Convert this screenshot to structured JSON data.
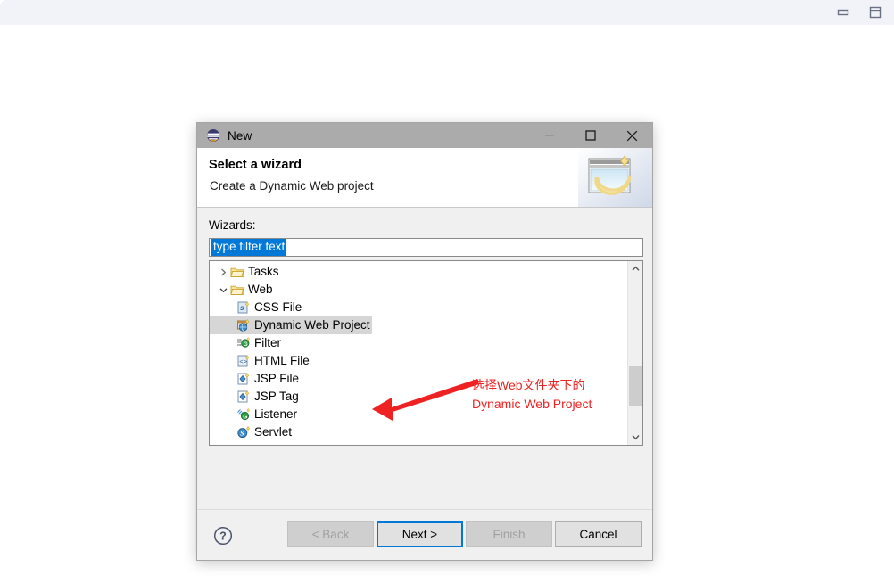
{
  "background_window": {
    "minimize_icon": "minimize-icon",
    "restore_icon": "restore-icon"
  },
  "dialog": {
    "titlebar": {
      "app_icon": "eclipse-icon",
      "title": "New",
      "minimize_label": "minimize-icon",
      "maximize_label": "maximize-icon",
      "close_label": "close-icon"
    },
    "header": {
      "title": "Select a wizard",
      "subtitle": "Create a Dynamic Web project",
      "banner_icon": "wizard-banner-icon"
    },
    "wizards_label": "Wizards:",
    "filter": {
      "value": "type filter text",
      "placeholder": "type filter text"
    },
    "tree": {
      "items": [
        {
          "label": "Tasks",
          "icon": "folder-icon",
          "indent": 1,
          "twisty": "collapsed",
          "selected": false
        },
        {
          "label": "Web",
          "icon": "folder-icon",
          "indent": 1,
          "twisty": "expanded",
          "selected": false
        },
        {
          "label": "CSS File",
          "icon": "css-file-icon",
          "indent": 2,
          "twisty": "none",
          "selected": false
        },
        {
          "label": "Dynamic Web Project",
          "icon": "web-project-icon",
          "indent": 2,
          "twisty": "none",
          "selected": true
        },
        {
          "label": "Filter",
          "icon": "filter-icon",
          "indent": 2,
          "twisty": "none",
          "selected": false
        },
        {
          "label": "HTML File",
          "icon": "html-file-icon",
          "indent": 2,
          "twisty": "none",
          "selected": false
        },
        {
          "label": "JSP File",
          "icon": "jsp-file-icon",
          "indent": 2,
          "twisty": "none",
          "selected": false
        },
        {
          "label": "JSP Tag",
          "icon": "jsp-tag-icon",
          "indent": 2,
          "twisty": "none",
          "selected": false
        },
        {
          "label": "Listener",
          "icon": "listener-icon",
          "indent": 2,
          "twisty": "none",
          "selected": false
        },
        {
          "label": "Servlet",
          "icon": "servlet-icon",
          "indent": 2,
          "twisty": "none",
          "selected": false
        }
      ],
      "scrollbar": {
        "up_icon": "chevron-up-icon",
        "down_icon": "chevron-down-icon"
      }
    },
    "annotation": {
      "line1": "选择Web文件夹下的",
      "line2": "Dynamic Web Project",
      "color": "#ee2222",
      "arrow_icon": "red-arrow-icon"
    },
    "footer": {
      "help_icon": "help-icon",
      "buttons": [
        {
          "label": "< Back",
          "state": "disabled"
        },
        {
          "label": "Next >",
          "state": "focused"
        },
        {
          "label": "Finish",
          "state": "disabled"
        },
        {
          "label": "Cancel",
          "state": "normal"
        }
      ]
    }
  },
  "colors": {
    "accent": "#0078d7",
    "annotation": "#ee2222",
    "titlebar": "#ababab",
    "dialog_bg": "#f0f0f0",
    "page_strip": "#f2f3f8"
  }
}
